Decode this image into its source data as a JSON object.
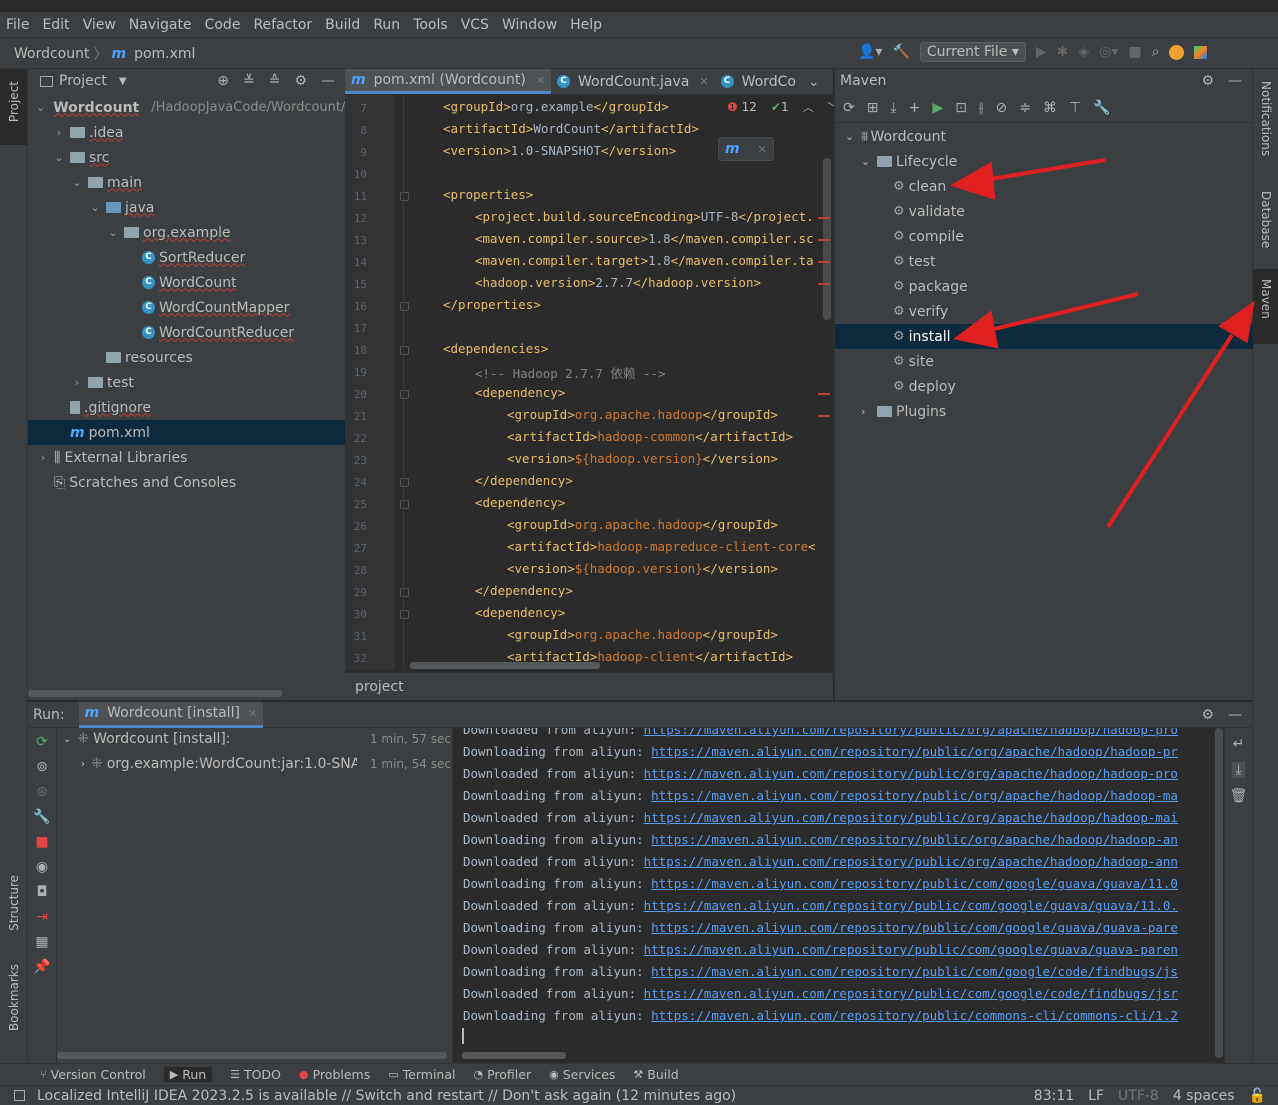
{
  "menu": [
    "File",
    "Edit",
    "View",
    "Navigate",
    "Code",
    "Refactor",
    "Build",
    "Run",
    "Tools",
    "VCS",
    "Window",
    "Help"
  ],
  "breadcrumb": {
    "project": "Wordcount",
    "file": "pom.xml"
  },
  "toolbar": {
    "run_config": "Current File"
  },
  "project_panel": {
    "title": "Project",
    "root": {
      "name": "Wordcount",
      "path": "/HadoopJavaCode/Wordcount/"
    },
    "items": [
      {
        "label": ".idea"
      },
      {
        "label": "src"
      },
      {
        "label": "main"
      },
      {
        "label": "java"
      },
      {
        "label": "org.example"
      },
      {
        "label": "SortReducer"
      },
      {
        "label": "WordCount"
      },
      {
        "label": "WordCountMapper"
      },
      {
        "label": "WordCountReducer"
      },
      {
        "label": "resources"
      },
      {
        "label": "test"
      },
      {
        "label": ".gitignore"
      },
      {
        "label": "pom.xml"
      },
      {
        "label": "External Libraries"
      },
      {
        "label": "Scratches and Consoles"
      }
    ]
  },
  "editor": {
    "tabs": [
      {
        "label": "pom.xml (Wordcount)"
      },
      {
        "label": "WordCount.java"
      },
      {
        "label": "WordCo"
      }
    ],
    "inspections": {
      "errors": "12",
      "ok": "1"
    },
    "breadcrumb": "project",
    "lines": [
      {
        "n": "7",
        "tag1": "<groupId>",
        "val": "org.example",
        "tag2": "</groupId>",
        "indent": 0
      },
      {
        "n": "8",
        "tag1": "<artifactId>",
        "val": "WordCount",
        "tag2": "</artifactId>",
        "indent": 0
      },
      {
        "n": "9",
        "tag1": "<version>",
        "val": "1.0-SNAPSHOT",
        "tag2": "</version>",
        "indent": 0
      },
      {
        "n": "10",
        "tag1": "",
        "val": "",
        "tag2": "",
        "indent": 0
      },
      {
        "n": "11",
        "tag1": "<properties>",
        "val": "",
        "tag2": "",
        "indent": 0
      },
      {
        "n": "12",
        "tag1": "<project.build.sourceEncoding>",
        "val": "UTF-8",
        "tag2": "</project.",
        "indent": 1
      },
      {
        "n": "13",
        "tag1": "<maven.compiler.source>",
        "val": "1.8",
        "tag2": "</maven.compiler.sc",
        "indent": 1
      },
      {
        "n": "14",
        "tag1": "<maven.compiler.target>",
        "val": "1.8",
        "tag2": "</maven.compiler.ta",
        "indent": 1
      },
      {
        "n": "15",
        "tag1": "<hadoop.version>",
        "val": "2.7.7",
        "tag2": "</hadoop.version>",
        "indent": 1
      },
      {
        "n": "16",
        "tag1": "</properties>",
        "val": "",
        "tag2": "",
        "indent": 0
      },
      {
        "n": "17",
        "tag1": "",
        "val": "",
        "tag2": "",
        "indent": 0
      },
      {
        "n": "18",
        "tag1": "<dependencies>",
        "val": "",
        "tag2": "",
        "indent": 0
      },
      {
        "n": "19",
        "comment": "<!-- Hadoop 2.7.7 依赖 -->",
        "indent": 1
      },
      {
        "n": "20",
        "tag1": "<dependency>",
        "val": "",
        "tag2": "",
        "indent": 1
      },
      {
        "n": "21",
        "tag1": "<groupId>",
        "val2": "org.apache.hadoop",
        "tag2": "</groupId>",
        "indent": 2
      },
      {
        "n": "22",
        "tag1": "<artifactId>",
        "val2": "hadoop-common",
        "tag2": "</artifactId>",
        "indent": 2
      },
      {
        "n": "23",
        "tag1": "<version>",
        "val2": "${hadoop.version}",
        "tag2": "</version>",
        "indent": 2
      },
      {
        "n": "24",
        "tag1": "</dependency>",
        "val": "",
        "tag2": "",
        "indent": 1
      },
      {
        "n": "25",
        "tag1": "<dependency>",
        "val": "",
        "tag2": "",
        "indent": 1
      },
      {
        "n": "26",
        "tag1": "<groupId>",
        "val2": "org.apache.hadoop",
        "tag2": "</groupId>",
        "indent": 2
      },
      {
        "n": "27",
        "tag1": "<artifactId>",
        "val2": "hadoop-mapreduce-client-core",
        "tag2": "<",
        "indent": 2
      },
      {
        "n": "28",
        "tag1": "<version>",
        "val2": "${hadoop.version}",
        "tag2": "</version>",
        "indent": 2
      },
      {
        "n": "29",
        "tag1": "</dependency>",
        "val": "",
        "tag2": "",
        "indent": 1
      },
      {
        "n": "30",
        "tag1": "<dependency>",
        "val": "",
        "tag2": "",
        "indent": 1
      },
      {
        "n": "31",
        "tag1": "<groupId>",
        "val2": "org.apache.hadoop",
        "tag2": "</groupId>",
        "indent": 2
      },
      {
        "n": "32",
        "tag1": "<artifactId>",
        "val2": "hadoop-client",
        "tag2": "</artifactId>",
        "indent": 2
      }
    ]
  },
  "maven": {
    "title": "Maven",
    "root": "Wordcount",
    "lifecycle": "Lifecycle",
    "goals": [
      "clean",
      "validate",
      "compile",
      "test",
      "package",
      "verify",
      "install",
      "site",
      "deploy"
    ],
    "plugins": "Plugins"
  },
  "side_tabs": {
    "project": "Project",
    "structure": "Structure",
    "bookmarks": "Bookmarks",
    "notifications": "Notifications",
    "database": "Database",
    "maven": "Maven"
  },
  "run": {
    "label": "Run:",
    "tab": "Wordcount [install]",
    "tree": [
      {
        "label": "Wordcount [install]:",
        "time": "1 min, 57 sec"
      },
      {
        "label": "org.example:WordCount:jar:1.0-SNAPSHOT",
        "time": "1 min, 54 sec"
      }
    ],
    "console": [
      {
        "verb": "Downloaded from aliyun: ",
        "url": "https://maven.aliyun.com/repository/public/org/apache/hadoop/hadoop-pro"
      },
      {
        "verb": "Downloading from aliyun: ",
        "url": "https://maven.aliyun.com/repository/public/org/apache/hadoop/hadoop-pr"
      },
      {
        "verb": "Downloaded from aliyun: ",
        "url": "https://maven.aliyun.com/repository/public/org/apache/hadoop/hadoop-pro"
      },
      {
        "verb": "Downloading from aliyun: ",
        "url": "https://maven.aliyun.com/repository/public/org/apache/hadoop/hadoop-ma"
      },
      {
        "verb": "Downloaded from aliyun: ",
        "url": "https://maven.aliyun.com/repository/public/org/apache/hadoop/hadoop-mai"
      },
      {
        "verb": "Downloading from aliyun: ",
        "url": "https://maven.aliyun.com/repository/public/org/apache/hadoop/hadoop-an"
      },
      {
        "verb": "Downloaded from aliyun: ",
        "url": "https://maven.aliyun.com/repository/public/org/apache/hadoop/hadoop-ann"
      },
      {
        "verb": "Downloading from aliyun: ",
        "url": "https://maven.aliyun.com/repository/public/com/google/guava/guava/11.0"
      },
      {
        "verb": "Downloaded from aliyun: ",
        "url": "https://maven.aliyun.com/repository/public/com/google/guava/guava/11.0."
      },
      {
        "verb": "Downloading from aliyun: ",
        "url": "https://maven.aliyun.com/repository/public/com/google/guava/guava-pare"
      },
      {
        "verb": "Downloaded from aliyun: ",
        "url": "https://maven.aliyun.com/repository/public/com/google/guava/guava-paren"
      },
      {
        "verb": "Downloading from aliyun: ",
        "url": "https://maven.aliyun.com/repository/public/com/google/code/findbugs/js"
      },
      {
        "verb": "Downloaded from aliyun: ",
        "url": "https://maven.aliyun.com/repository/public/com/google/code/findbugs/jsr"
      },
      {
        "verb": "Downloading from aliyun: ",
        "url": "https://maven.aliyun.com/repository/public/commons-cli/commons-cli/1.2"
      }
    ]
  },
  "bottom_tabs": [
    "Version Control",
    "Run",
    "TODO",
    "Problems",
    "Terminal",
    "Profiler",
    "Services",
    "Build"
  ],
  "status": {
    "message": "Localized IntelliJ IDEA 2023.2.5 is available // Switch and restart // Don't ask again (12 minutes ago)",
    "position": "83:11",
    "line_sep": "LF",
    "encoding": "UTF-8",
    "indent": "4 spaces"
  },
  "colors": {
    "accent": "#4a88c7",
    "selection": "#0d293e",
    "arrow": "#e02020"
  }
}
